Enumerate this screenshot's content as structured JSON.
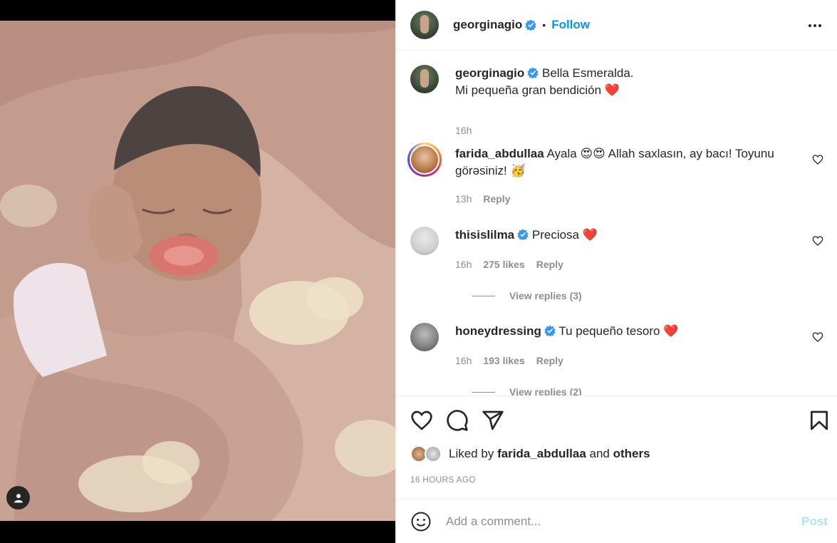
{
  "post": {
    "owner": "georginagio",
    "follow_label": "Follow",
    "separator": "•",
    "caption_line1": "Bella Esmeralda.",
    "caption_line2": "Mi pequeña gran bendición ❤️",
    "caption_time": "16h"
  },
  "comments": [
    {
      "user": "farida_abdullaa",
      "text": "Ayala 😍😍 Allah saxlasın, ay bacı! Toyunu görəsiniz! 🥳",
      "time": "13h",
      "reply_label": "Reply"
    },
    {
      "user": "thisislilma",
      "text": "Preciosa ❤️",
      "time": "16h",
      "likes": "275 likes",
      "reply_label": "Reply",
      "view_replies": "View replies (3)"
    },
    {
      "user": "honeydressing",
      "text": "Tu pequeño tesoro ❤️",
      "time": "16h",
      "likes": "193 likes",
      "reply_label": "Reply",
      "view_replies": "View replies (2)"
    }
  ],
  "likes": {
    "prefix": "Liked by",
    "user": "farida_abdullaa",
    "and": "and",
    "others": "others"
  },
  "timestamp": "16 HOURS AGO",
  "composer": {
    "placeholder": "Add a comment...",
    "post_label": "Post"
  },
  "colors": {
    "accent": "#0095f6",
    "verified": "#3897f0",
    "heart": "#ed4956",
    "muted": "#8e8e8e"
  },
  "icons": [
    "verified-badge-icon",
    "more-options-icon",
    "heart-icon",
    "comment-icon",
    "share-icon",
    "bookmark-icon",
    "emoji-icon",
    "user-tag-icon"
  ]
}
